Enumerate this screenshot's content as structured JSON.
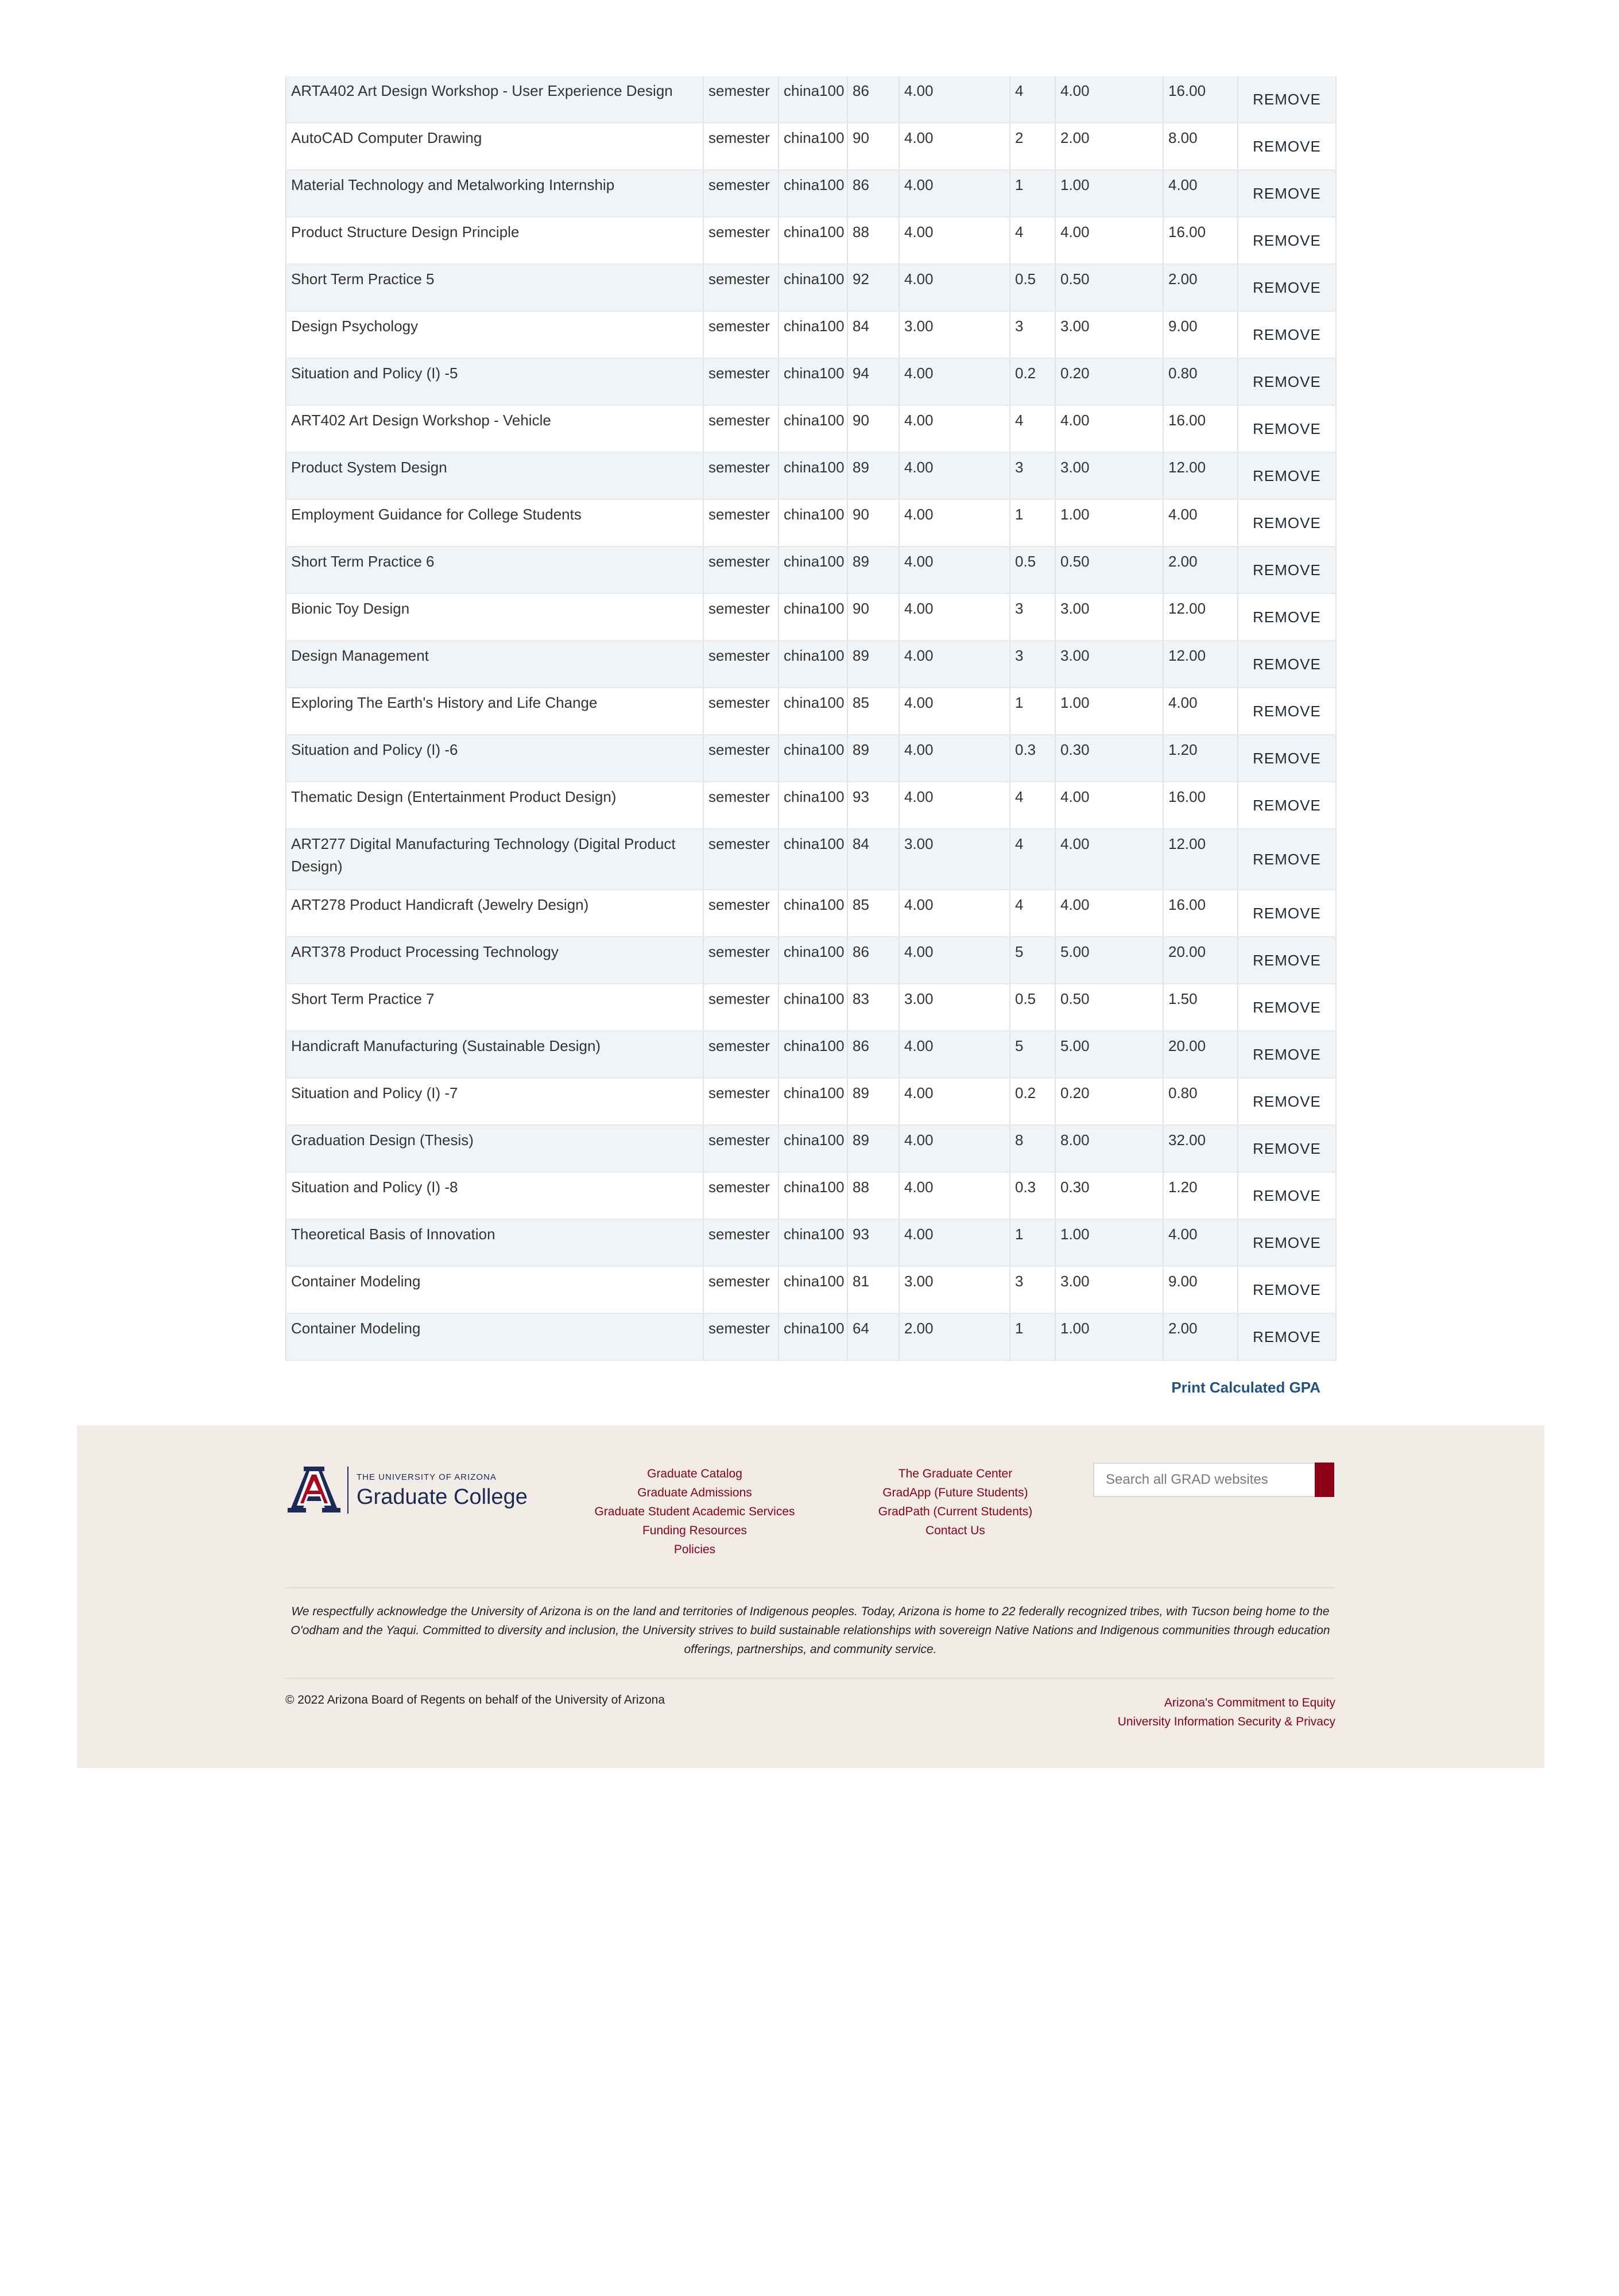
{
  "courses": [
    {
      "name": "ARTA402 Art Design Workshop - User Experience Design",
      "term": "semester",
      "scale": "china100",
      "score": "86",
      "grade_points": "4.00",
      "credits": "4",
      "credits_calc": "4.00",
      "quality_points": "16.00",
      "action": "REMOVE"
    },
    {
      "name": "AutoCAD Computer Drawing",
      "term": "semester",
      "scale": "china100",
      "score": "90",
      "grade_points": "4.00",
      "credits": "2",
      "credits_calc": "2.00",
      "quality_points": "8.00",
      "action": "REMOVE"
    },
    {
      "name": "Material Technology and Metalworking Internship",
      "term": "semester",
      "scale": "china100",
      "score": "86",
      "grade_points": "4.00",
      "credits": "1",
      "credits_calc": "1.00",
      "quality_points": "4.00",
      "action": "REMOVE"
    },
    {
      "name": "Product Structure Design Principle",
      "term": "semester",
      "scale": "china100",
      "score": "88",
      "grade_points": "4.00",
      "credits": "4",
      "credits_calc": "4.00",
      "quality_points": "16.00",
      "action": "REMOVE"
    },
    {
      "name": "Short Term Practice 5",
      "term": "semester",
      "scale": "china100",
      "score": "92",
      "grade_points": "4.00",
      "credits": "0.5",
      "credits_calc": "0.50",
      "quality_points": "2.00",
      "action": "REMOVE"
    },
    {
      "name": "Design Psychology",
      "term": "semester",
      "scale": "china100",
      "score": "84",
      "grade_points": "3.00",
      "credits": "3",
      "credits_calc": "3.00",
      "quality_points": "9.00",
      "action": "REMOVE"
    },
    {
      "name": "Situation and Policy (I) -5",
      "term": "semester",
      "scale": "china100",
      "score": "94",
      "grade_points": "4.00",
      "credits": "0.2",
      "credits_calc": "0.20",
      "quality_points": "0.80",
      "action": "REMOVE"
    },
    {
      "name": "ART402 Art Design Workshop - Vehicle",
      "term": "semester",
      "scale": "china100",
      "score": "90",
      "grade_points": "4.00",
      "credits": "4",
      "credits_calc": "4.00",
      "quality_points": "16.00",
      "action": "REMOVE"
    },
    {
      "name": "Product System Design",
      "term": "semester",
      "scale": "china100",
      "score": "89",
      "grade_points": "4.00",
      "credits": "3",
      "credits_calc": "3.00",
      "quality_points": "12.00",
      "action": "REMOVE"
    },
    {
      "name": "Employment Guidance for College Students",
      "term": "semester",
      "scale": "china100",
      "score": "90",
      "grade_points": "4.00",
      "credits": "1",
      "credits_calc": "1.00",
      "quality_points": "4.00",
      "action": "REMOVE"
    },
    {
      "name": "Short Term Practice 6",
      "term": "semester",
      "scale": "china100",
      "score": "89",
      "grade_points": "4.00",
      "credits": "0.5",
      "credits_calc": "0.50",
      "quality_points": "2.00",
      "action": "REMOVE"
    },
    {
      "name": "Bionic Toy Design",
      "term": "semester",
      "scale": "china100",
      "score": "90",
      "grade_points": "4.00",
      "credits": "3",
      "credits_calc": "3.00",
      "quality_points": "12.00",
      "action": "REMOVE"
    },
    {
      "name": "Design Management",
      "term": "semester",
      "scale": "china100",
      "score": "89",
      "grade_points": "4.00",
      "credits": "3",
      "credits_calc": "3.00",
      "quality_points": "12.00",
      "action": "REMOVE"
    },
    {
      "name": "Exploring The Earth's History and Life Change",
      "term": "semester",
      "scale": "china100",
      "score": "85",
      "grade_points": "4.00",
      "credits": "1",
      "credits_calc": "1.00",
      "quality_points": "4.00",
      "action": "REMOVE"
    },
    {
      "name": "Situation and Policy (I) -6",
      "term": "semester",
      "scale": "china100",
      "score": "89",
      "grade_points": "4.00",
      "credits": "0.3",
      "credits_calc": "0.30",
      "quality_points": "1.20",
      "action": "REMOVE"
    },
    {
      "name": "Thematic Design (Entertainment Product Design)",
      "term": "semester",
      "scale": "china100",
      "score": "93",
      "grade_points": "4.00",
      "credits": "4",
      "credits_calc": "4.00",
      "quality_points": "16.00",
      "action": "REMOVE"
    },
    {
      "name": "ART277 Digital Manufacturing Technology (Digital Product Design)",
      "term": "semester",
      "scale": "china100",
      "score": "84",
      "grade_points": "3.00",
      "credits": "4",
      "credits_calc": "4.00",
      "quality_points": "12.00",
      "action": "REMOVE"
    },
    {
      "name": "ART278 Product Handicraft (Jewelry Design)",
      "term": "semester",
      "scale": "china100",
      "score": "85",
      "grade_points": "4.00",
      "credits": "4",
      "credits_calc": "4.00",
      "quality_points": "16.00",
      "action": "REMOVE"
    },
    {
      "name": "ART378 Product Processing Technology",
      "term": "semester",
      "scale": "china100",
      "score": "86",
      "grade_points": "4.00",
      "credits": "5",
      "credits_calc": "5.00",
      "quality_points": "20.00",
      "action": "REMOVE"
    },
    {
      "name": "Short Term Practice 7",
      "term": "semester",
      "scale": "china100",
      "score": "83",
      "grade_points": "3.00",
      "credits": "0.5",
      "credits_calc": "0.50",
      "quality_points": "1.50",
      "action": "REMOVE"
    },
    {
      "name": "Handicraft Manufacturing (Sustainable Design)",
      "term": "semester",
      "scale": "china100",
      "score": "86",
      "grade_points": "4.00",
      "credits": "5",
      "credits_calc": "5.00",
      "quality_points": "20.00",
      "action": "REMOVE"
    },
    {
      "name": "Situation and Policy (I) -7",
      "term": "semester",
      "scale": "china100",
      "score": "89",
      "grade_points": "4.00",
      "credits": "0.2",
      "credits_calc": "0.20",
      "quality_points": "0.80",
      "action": "REMOVE"
    },
    {
      "name": "Graduation Design (Thesis)",
      "term": "semester",
      "scale": "china100",
      "score": "89",
      "grade_points": "4.00",
      "credits": "8",
      "credits_calc": "8.00",
      "quality_points": "32.00",
      "action": "REMOVE"
    },
    {
      "name": "Situation and Policy (I) -8",
      "term": "semester",
      "scale": "china100",
      "score": "88",
      "grade_points": "4.00",
      "credits": "0.3",
      "credits_calc": "0.30",
      "quality_points": "1.20",
      "action": "REMOVE"
    },
    {
      "name": "Theoretical Basis of Innovation",
      "term": "semester",
      "scale": "china100",
      "score": "93",
      "grade_points": "4.00",
      "credits": "1",
      "credits_calc": "1.00",
      "quality_points": "4.00",
      "action": "REMOVE"
    },
    {
      "name": "Container Modeling",
      "term": "semester",
      "scale": "china100",
      "score": "81",
      "grade_points": "3.00",
      "credits": "3",
      "credits_calc": "3.00",
      "quality_points": "9.00",
      "action": "REMOVE"
    },
    {
      "name": "Container Modeling",
      "term": "semester",
      "scale": "china100",
      "score": "64",
      "grade_points": "2.00",
      "credits": "1",
      "credits_calc": "1.00",
      "quality_points": "2.00",
      "action": "REMOVE"
    }
  ],
  "actions": {
    "print_label": "Print Calculated GPA"
  },
  "footer": {
    "logo": {
      "small_text": "THE UNIVERSITY OF ARIZONA",
      "big_text": "Graduate College",
      "mark_letter": "A",
      "navy": "#1e2a55",
      "red": "#ab0520"
    },
    "links_col1": [
      "Graduate Catalog",
      "Graduate Admissions",
      "Graduate Student Academic Services",
      "Funding Resources",
      "Policies"
    ],
    "links_col2": [
      "The Graduate Center",
      "GradApp (Future Students)",
      "GradPath (Current Students)",
      "Contact Us"
    ],
    "search": {
      "placeholder": "Search all GRAD websites",
      "button_color": "#8b0015"
    },
    "land_acknowledgement": "We respectfully acknowledge the University of Arizona is on the land and territories of Indigenous peoples. Today, Arizona is home to 22 federally recognized tribes, with Tucson being home to the O'odham and the Yaqui. Committed to diversity and inclusion, the University strives to build sustainable relationships with sovereign Native Nations and Indigenous communities through education offerings, partnerships, and community service.",
    "copyright": "© 2022 Arizona Board of Regents on behalf of the University of Arizona",
    "legal_links": [
      "Arizona's Commitment to Equity",
      "University Information Security & Privacy"
    ]
  },
  "colors": {
    "link_red": "#8b0015",
    "link_blue": "#1e5288",
    "footer_bg": "#f1ede6",
    "row_stripe": "#f1f4f7"
  }
}
